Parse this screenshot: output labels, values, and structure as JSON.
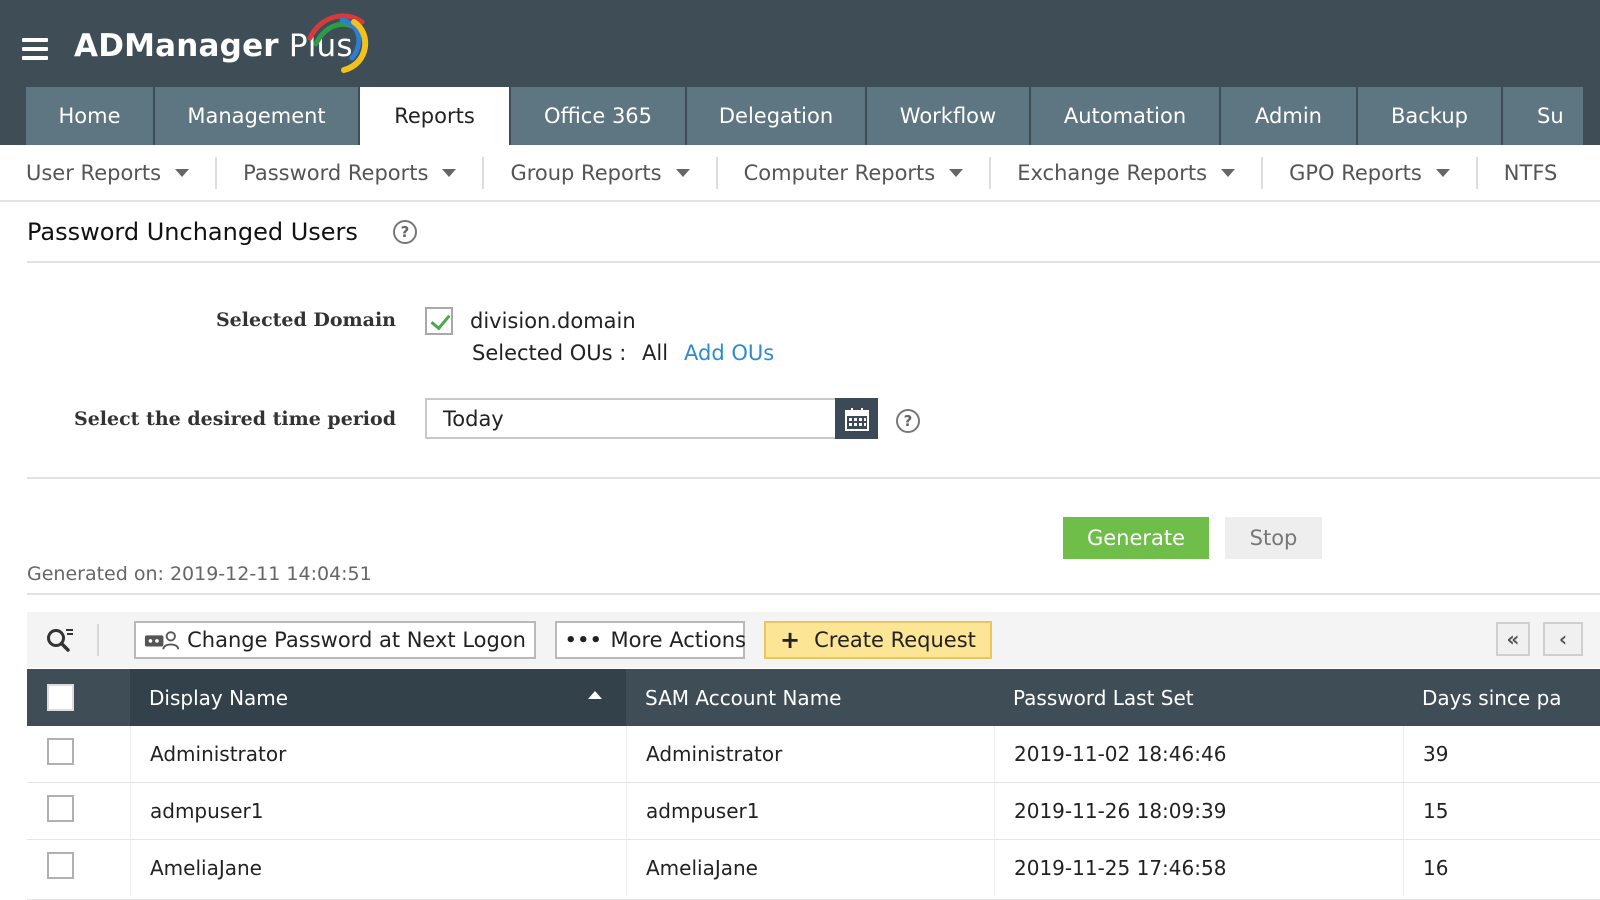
{
  "app": {
    "logo_text_bold": "ADManager",
    "logo_text_light": " Plus"
  },
  "nav": {
    "tabs": [
      {
        "label": "Home"
      },
      {
        "label": "Management"
      },
      {
        "label": "Reports"
      },
      {
        "label": "Office 365"
      },
      {
        "label": "Delegation"
      },
      {
        "label": "Workflow"
      },
      {
        "label": "Automation"
      },
      {
        "label": "Admin"
      },
      {
        "label": "Backup"
      },
      {
        "label": "Su"
      }
    ],
    "active_tab": "Reports"
  },
  "subnav": {
    "items": [
      {
        "label": "User Reports"
      },
      {
        "label": "Password Reports"
      },
      {
        "label": "Group Reports"
      },
      {
        "label": "Computer Reports"
      },
      {
        "label": "Exchange Reports"
      },
      {
        "label": "GPO Reports"
      },
      {
        "label": "NTFS"
      }
    ]
  },
  "page": {
    "title": "Password Unchanged Users"
  },
  "form": {
    "domain_label": "Selected Domain",
    "domain_value": "division.domain",
    "domain_checked": true,
    "ous_label": "Selected OUs :",
    "ous_value": "All",
    "add_ous_link": "Add OUs",
    "period_label": "Select the desired time period",
    "period_value": "Today"
  },
  "actions": {
    "generate_label": "Generate",
    "stop_label": "Stop",
    "generated_on": "Generated on: 2019-12-11 14:04:51"
  },
  "toolbar": {
    "change_password_label": "Change Password at Next Logon",
    "more_actions_label": "More Actions",
    "create_request_label": "Create Request",
    "first_page_glyph": "«",
    "prev_page_glyph": "‹"
  },
  "table": {
    "columns": [
      "Display Name",
      "SAM Account Name",
      "Password Last Set",
      "Days since pa"
    ],
    "sorted_column": "Display Name",
    "sort_direction": "ascending",
    "rows": [
      {
        "display_name": "Administrator",
        "sam": "Administrator",
        "last_set": "2019-11-02 18:46:46",
        "days": "39"
      },
      {
        "display_name": "admpuser1",
        "sam": "admpuser1",
        "last_set": "2019-11-26 18:09:39",
        "days": "15"
      },
      {
        "display_name": "AmeliaJane",
        "sam": "AmeliaJane",
        "last_set": "2019-11-25 17:46:58",
        "days": "16"
      }
    ]
  },
  "colors": {
    "header_bg": "#3f4d57",
    "tab_bg": "#5e7582",
    "generate_green": "#6fbe4a",
    "link_blue": "#2e8bd0",
    "create_request_yellow": "#fde596"
  }
}
